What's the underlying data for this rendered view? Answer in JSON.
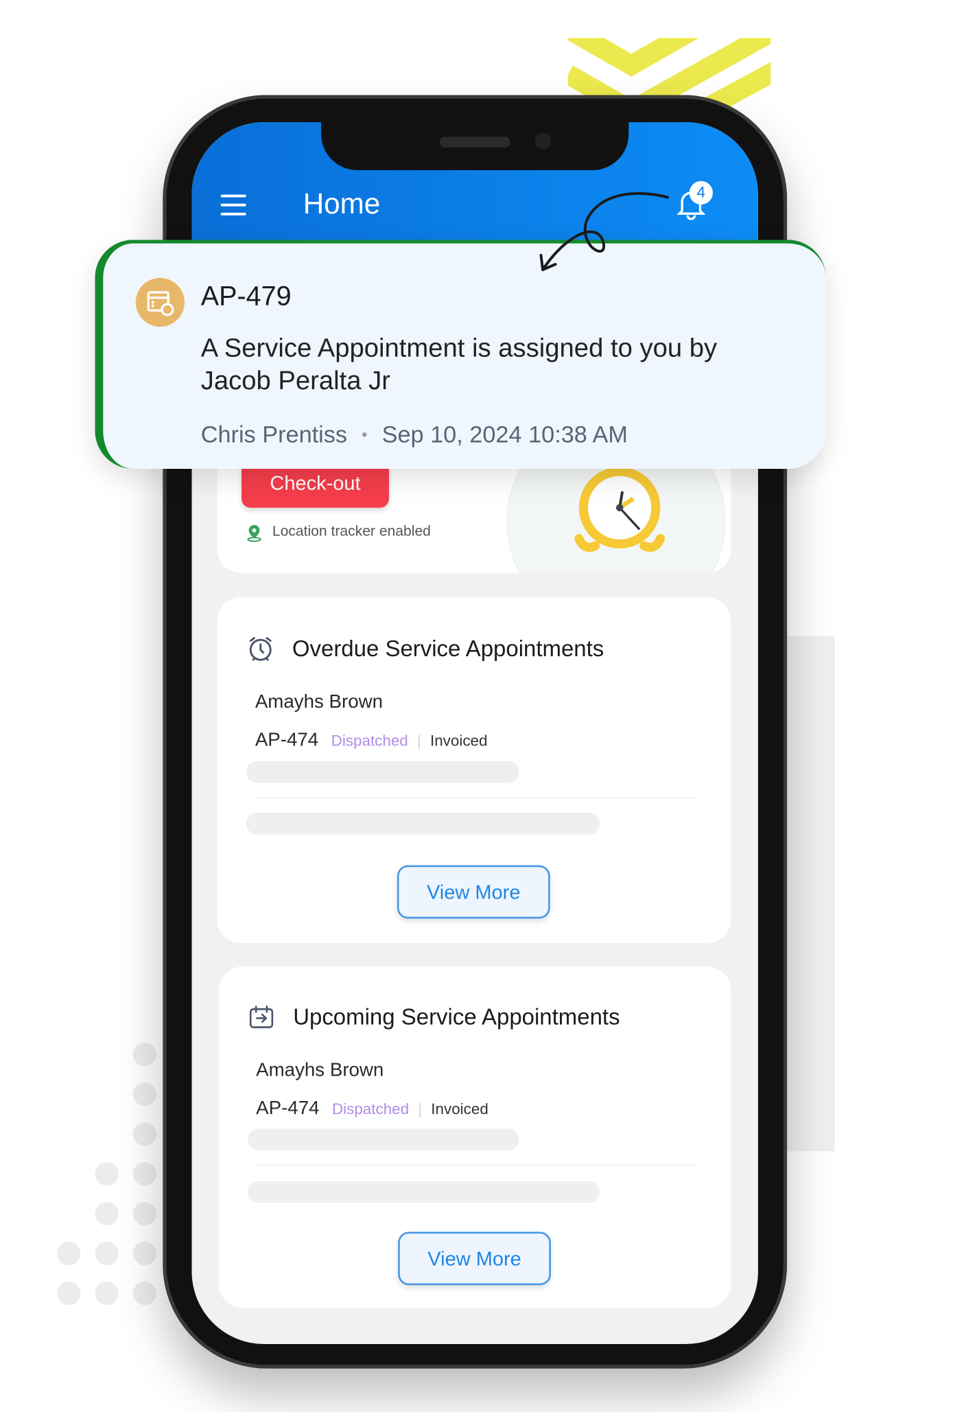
{
  "header": {
    "title": "Home",
    "menu_icon": "hamburger-icon",
    "bell_icon": "bell-icon",
    "notification_count": "4"
  },
  "notification": {
    "icon": "calendar-gear-icon",
    "title": "AP-479",
    "message_line1": "A Service Appointment is assigned to you by",
    "message_line2": "Jacob Peralta Jr",
    "author": "Chris Prentiss",
    "separator": "•",
    "timestamp": "Sep 10, 2024 10:38 AM",
    "accent": "#148a2d"
  },
  "attendance": {
    "checkout_label": "Check-out",
    "location_text": "Location tracker enabled",
    "checkout_color": "#f53d4b"
  },
  "overdue": {
    "title": "Overdue Service Appointments",
    "customer": "Amayhs Brown",
    "code": "AP-474",
    "status": "Dispatched",
    "divider": "|",
    "billing": "Invoiced",
    "view_more": "View More"
  },
  "upcoming": {
    "title": "Upcoming Service Appointments",
    "customer": "Amayhs Brown",
    "code": "AP-474",
    "status": "Dispatched",
    "divider": "|",
    "billing": "Invoiced",
    "view_more": "View More"
  }
}
